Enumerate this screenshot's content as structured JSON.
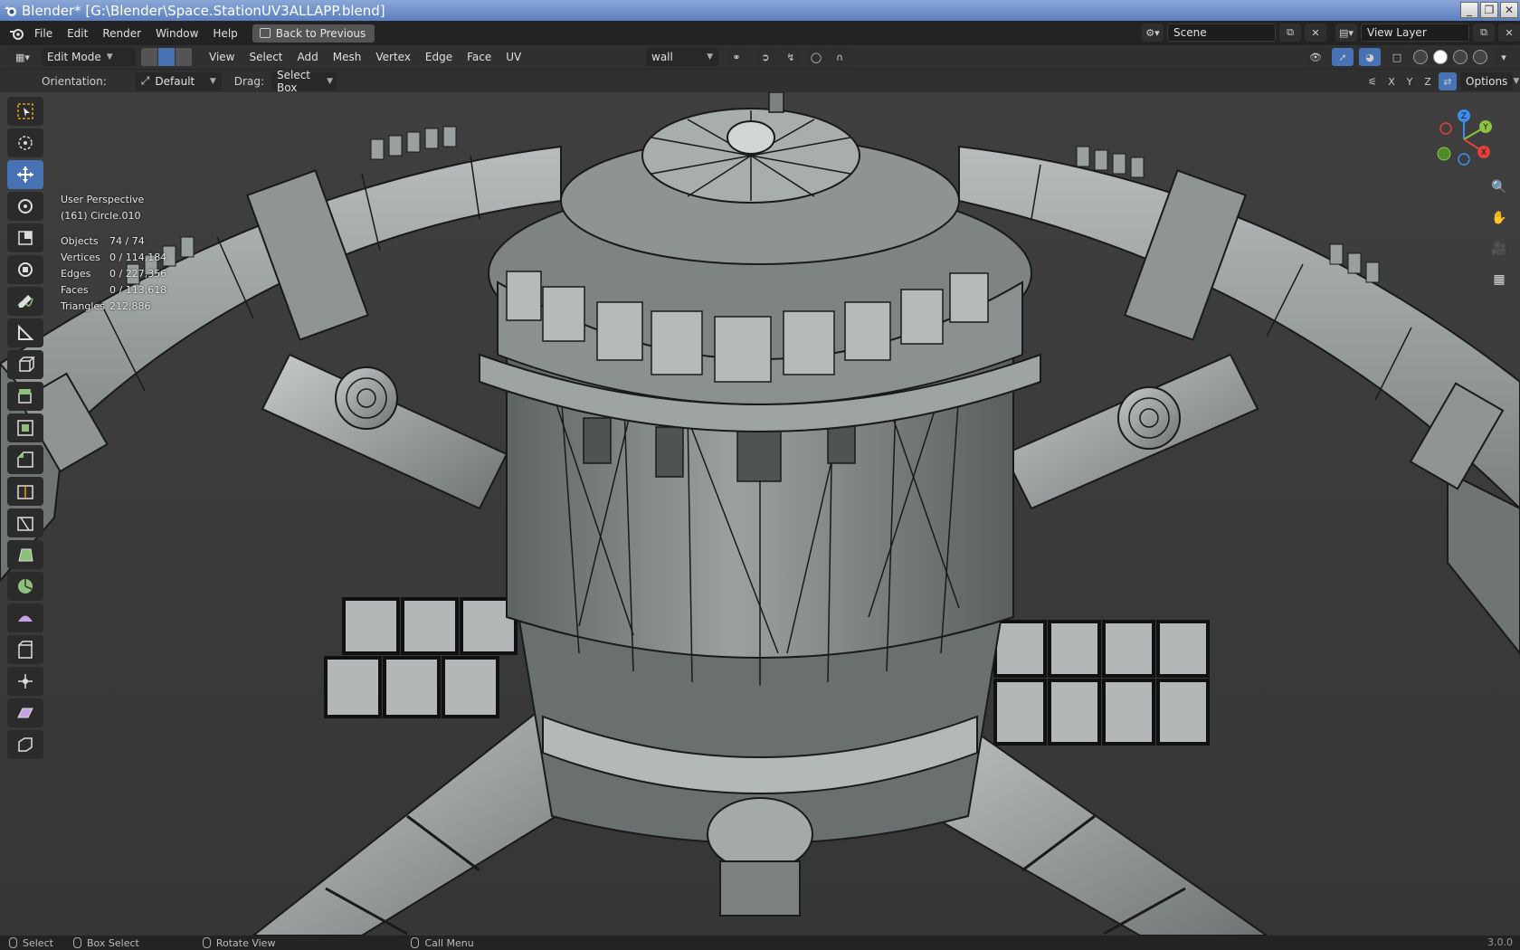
{
  "window": {
    "title": "Blender* [G:\\Blender\\Space.StationUV3ALLAPP.blend]",
    "buttons": [
      "_",
      "❐",
      "✕"
    ]
  },
  "topbar": {
    "menus": [
      "File",
      "Edit",
      "Render",
      "Window",
      "Help"
    ],
    "back_button": "Back to Previous",
    "scene": "Scene",
    "view_layer": "View Layer"
  },
  "header": {
    "mode": "Edit Mode",
    "menus": [
      "View",
      "Select",
      "Add",
      "Mesh",
      "Vertex",
      "Edge",
      "Face",
      "UV"
    ],
    "vertex_group": "wall"
  },
  "tool_settings": {
    "orientation_label": "Orientation:",
    "orientation_value": "Default",
    "drag_label": "Drag:",
    "drag_value": "Select Box",
    "axes": [
      "X",
      "Y",
      "Z"
    ],
    "options": "Options"
  },
  "overlay": {
    "view_name": "User Perspective",
    "object_name": "(161) Circle.010",
    "stats": [
      {
        "label": "Objects",
        "value": "74 / 74"
      },
      {
        "label": "Vertices",
        "value": "0 / 114,184"
      },
      {
        "label": "Edges",
        "value": "0 / 227,356"
      },
      {
        "label": "Faces",
        "value": "0 / 113,618"
      },
      {
        "label": "Triangles",
        "value": "212,886"
      }
    ]
  },
  "gizmo": {
    "x": "X",
    "y": "Y",
    "z": "Z"
  },
  "statusbar": {
    "select": "Select",
    "box_select": "Box Select",
    "rotate_view": "Rotate View",
    "call_menu": "Call Menu",
    "version": "3.0.0"
  },
  "colors": {
    "accent": "#4772b3",
    "gizmo_x": "#e0423f",
    "gizmo_y": "#8cc43f",
    "gizmo_z": "#3b8ef0"
  }
}
